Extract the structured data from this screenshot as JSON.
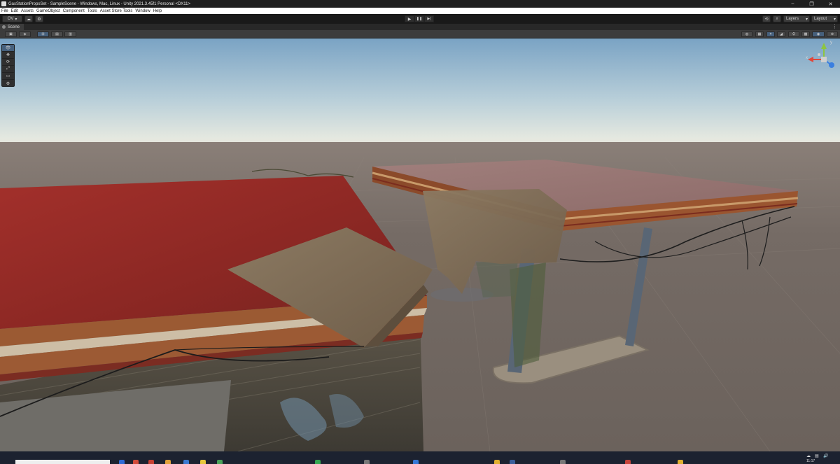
{
  "window": {
    "title": "GasStationPropsSet - SampleScene - Windows, Mac, Linux - Unity 2021.3.45f1 Personal <DX11>",
    "minimize": "–",
    "maximize": "❐",
    "close": "✕"
  },
  "menu": [
    "File",
    "Edit",
    "Assets",
    "GameObject",
    "Component",
    "Tools",
    "Asset Store Tools",
    "Window",
    "Help"
  ],
  "toolbar": {
    "account_label": "OV",
    "account_arrow": "▾",
    "cloud_glyph": "☁",
    "collab_glyph": "⚙",
    "play_glyph": "▶",
    "pause_glyph": "❚❚",
    "step_glyph": "▶|",
    "history_glyph": "⟲",
    "search_glyph": "⌕",
    "layers_label": "Layers",
    "layout_label": "Layout"
  },
  "scene_tab": {
    "label": "Scene",
    "more": "⋮"
  },
  "scene_toolbar": {
    "left_glyphs": [
      "▣",
      "◈",
      "⊞",
      "▤",
      "▥"
    ],
    "right_glyphs": [
      "◍",
      "▦",
      "✦",
      "◢",
      "⛭",
      "▩",
      "◉",
      "⊕"
    ],
    "overlay_arrow": "▾"
  },
  "tools": [
    "👁",
    "✥",
    "⟳",
    "⤢",
    "▭",
    "⚙"
  ],
  "gizmo": {
    "y_label": "y",
    "x_label": "x",
    "mode_label": "≡"
  },
  "taskbar": {
    "time": "11:17",
    "tray": [
      "☁",
      "▤",
      "🔊"
    ]
  },
  "colors": {
    "sky_top": "#7fa7c7",
    "horizon": "#e9eadf",
    "ground": "#6b625c",
    "canopy_red": "#8e2a26",
    "canopy_pink": "#9b7a78",
    "selection_blue": "#46607c"
  }
}
